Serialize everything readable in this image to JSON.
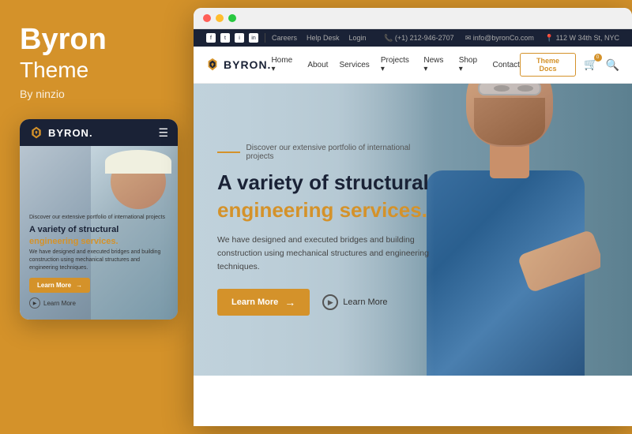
{
  "background_color": "#D4922A",
  "left_panel": {
    "title_line1": "Byron",
    "title_line2": "Theme",
    "by_text": "By ninzio"
  },
  "mobile_mockup": {
    "dots": [
      {
        "color": "#ff5f57"
      },
      {
        "color": "#ffbd2e"
      },
      {
        "color": "#28c840"
      }
    ],
    "logo_text": "BYRON.",
    "tagline": "Discover our extensive portfolio of international projects",
    "hero_title": "A variety of structural",
    "hero_title_orange": "engineering services.",
    "hero_desc": "We have designed and executed bridges and building construction using mechanical structures and engineering techniques.",
    "btn_primary": "Learn More",
    "btn_secondary": "Learn More"
  },
  "desktop_mockup": {
    "window_dots": [
      {
        "color": "#ff5f57"
      },
      {
        "color": "#ffbd2e"
      },
      {
        "color": "#28c840"
      }
    ],
    "topbar": {
      "social_icons": [
        "f",
        "t",
        "i",
        "in"
      ],
      "links": [
        "Careers",
        "Help Desk",
        "Login"
      ],
      "phone": "(+1) 212-946-2707",
      "email": "info@byronCo.com",
      "address": "112 W 34th St, NYC"
    },
    "navbar": {
      "logo_text": "BYRON.",
      "links": [
        "Home",
        "About",
        "Services",
        "Projects",
        "News",
        "Shop",
        "Contact"
      ],
      "btn_docs": "Theme Docs"
    },
    "hero": {
      "tagline": "Discover our extensive portfolio of international projects",
      "title": "A variety of structural",
      "title_orange": "engineering services.",
      "description": "We have designed and executed bridges and building construction using mechanical structures and engineering techniques.",
      "btn_primary": "Learn More",
      "btn_secondary": "Learn More"
    }
  }
}
